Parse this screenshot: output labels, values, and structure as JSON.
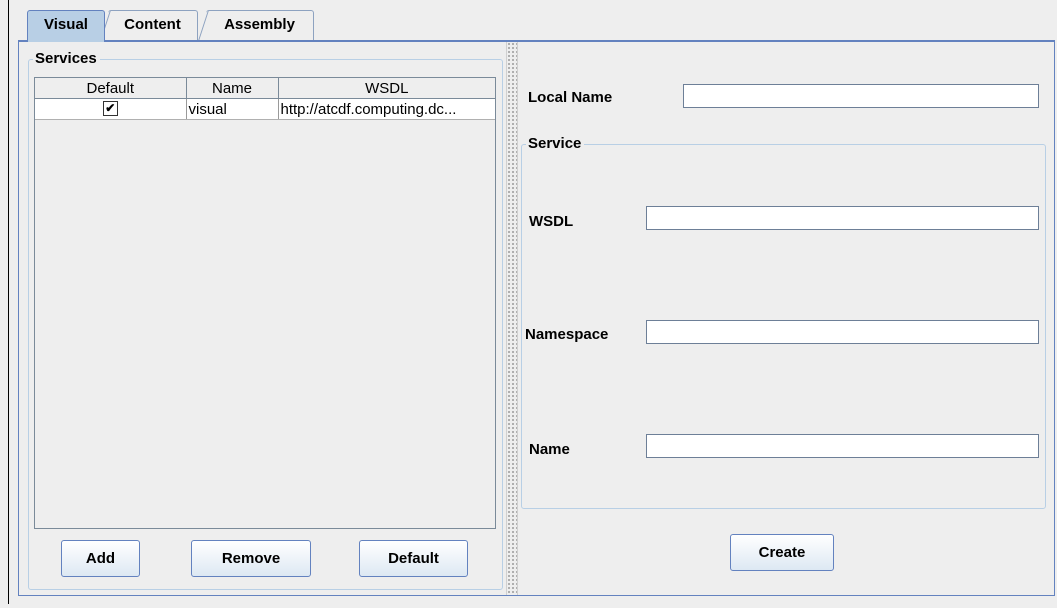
{
  "tabs": [
    {
      "label": "Visual",
      "selected": true
    },
    {
      "label": "Content",
      "selected": false
    },
    {
      "label": "Assembly",
      "selected": false
    }
  ],
  "services_panel": {
    "title": "Services",
    "table": {
      "columns": [
        "Default",
        "Name",
        "WSDL"
      ],
      "rows": [
        {
          "default_checked": true,
          "checkmark": "✔",
          "name": "visual",
          "wsdl": "http://atcdf.computing.dc..."
        }
      ]
    },
    "buttons": {
      "add": "Add",
      "remove": "Remove",
      "default": "Default"
    }
  },
  "details_panel": {
    "local_name_label": "Local Name",
    "local_name_value": "",
    "service_group_title": "Service",
    "wsdl_label": "WSDL",
    "wsdl_value": "",
    "namespace_label": "Namespace",
    "namespace_value": "",
    "name_label": "Name",
    "name_value": "",
    "create_button": "Create"
  },
  "colors": {
    "background": "#eeeeee",
    "selected_tab": "#b8cfe5",
    "border_blue": "#6382bf"
  }
}
